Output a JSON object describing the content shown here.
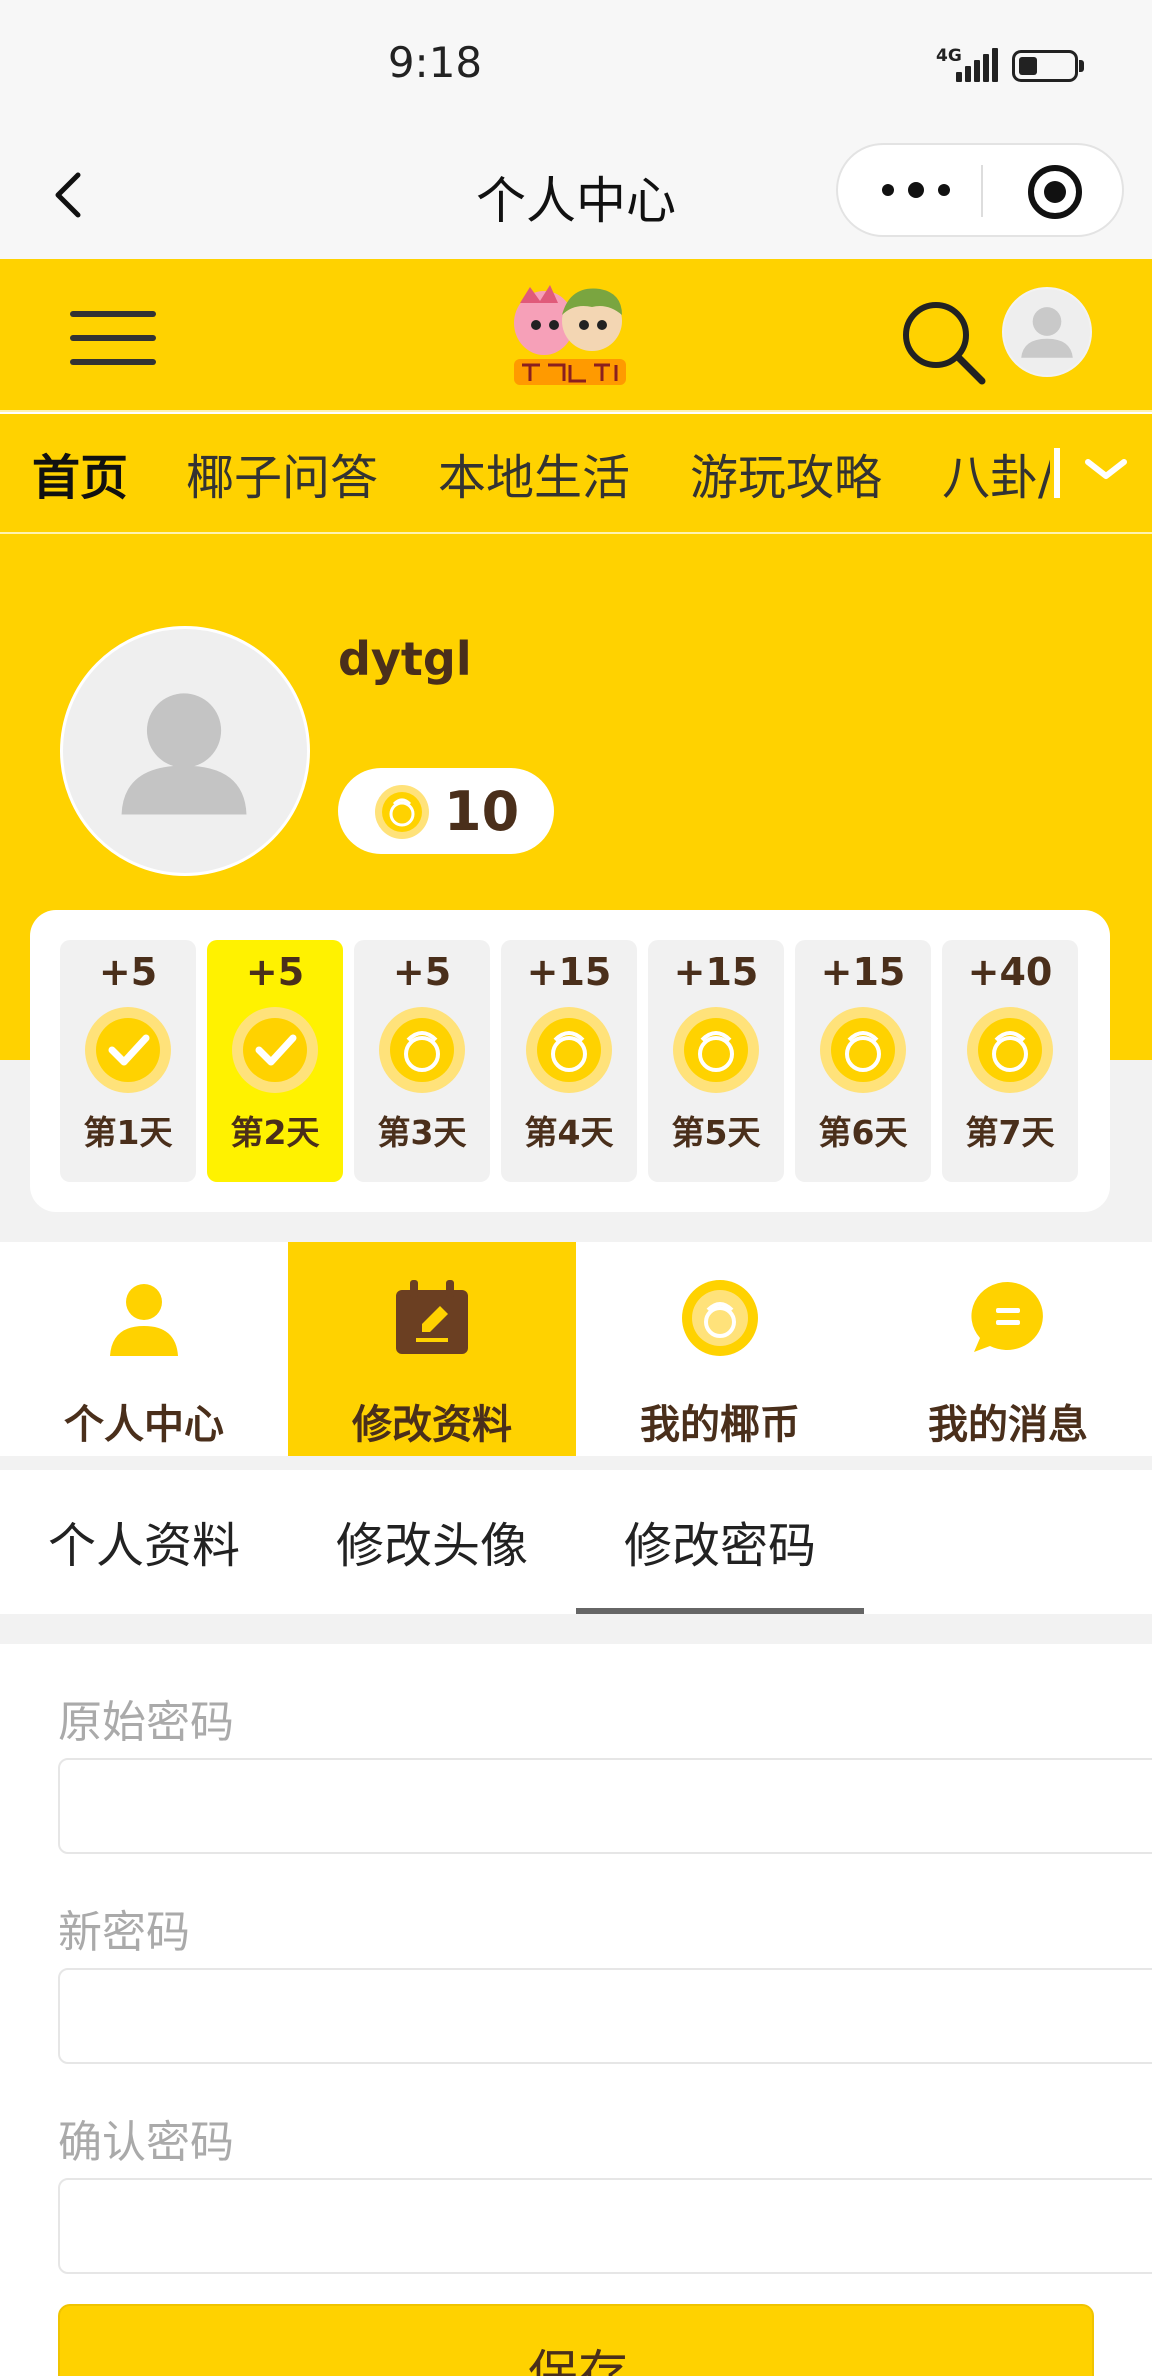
{
  "status_bar": {
    "time": "9:18",
    "network": "4G"
  },
  "title_bar": {
    "title": "个人中心"
  },
  "nav": {
    "tabs": [
      {
        "label": "首页",
        "active": true
      },
      {
        "label": "椰子问答",
        "active": false
      },
      {
        "label": "本地生活",
        "active": false
      },
      {
        "label": "游玩攻略",
        "active": false
      },
      {
        "label": "八卦/",
        "active": false
      }
    ]
  },
  "profile": {
    "username": "dytgl",
    "coins": "10"
  },
  "checkin": {
    "days": [
      {
        "points": "+5",
        "label": "第1天",
        "status": "checked"
      },
      {
        "points": "+5",
        "label": "第2天",
        "status": "checked-today"
      },
      {
        "points": "+5",
        "label": "第3天",
        "status": "pending"
      },
      {
        "points": "+15",
        "label": "第4天",
        "status": "pending"
      },
      {
        "points": "+15",
        "label": "第5天",
        "status": "pending"
      },
      {
        "points": "+15",
        "label": "第6天",
        "status": "pending"
      },
      {
        "points": "+40",
        "label": "第7天",
        "status": "pending"
      }
    ]
  },
  "features": [
    {
      "label": "个人中心",
      "icon": "user-icon",
      "active": false
    },
    {
      "label": "修改资料",
      "icon": "calendar-edit-icon",
      "active": true
    },
    {
      "label": "我的椰币",
      "icon": "coin-icon",
      "active": false
    },
    {
      "label": "我的消息",
      "icon": "message-icon",
      "active": false
    }
  ],
  "subtabs": [
    {
      "label": "个人资料",
      "active": false
    },
    {
      "label": "修改头像",
      "active": false
    },
    {
      "label": "修改密码",
      "active": true
    }
  ],
  "form": {
    "old_password_label": "原始密码",
    "new_password_label": "新密码",
    "confirm_password_label": "确认密码",
    "save_label": "保存"
  },
  "colors": {
    "brand_yellow": "#ffd200",
    "today_yellow": "#fff200",
    "text_brown": "#4a2f1b"
  }
}
